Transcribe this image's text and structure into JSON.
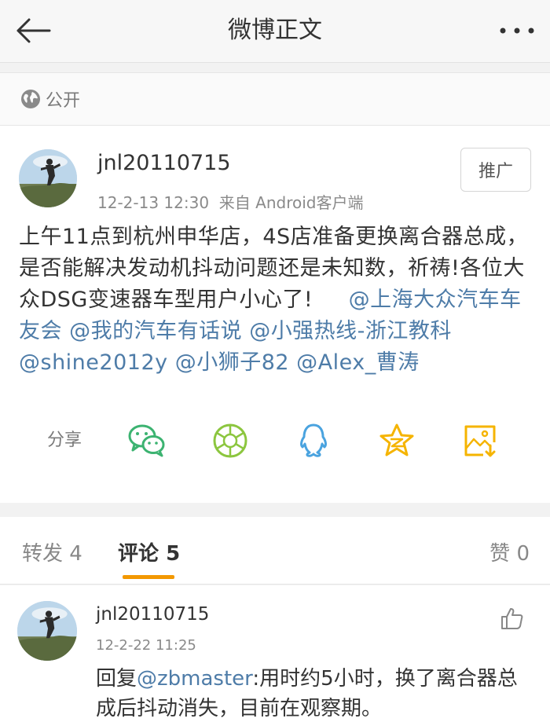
{
  "header": {
    "title": "微博正文"
  },
  "visibility": {
    "label": "公开"
  },
  "post": {
    "author": "jnl20110715",
    "timestamp": "12-2-13 12:30",
    "source": "来自 Android客户端",
    "promote_label": "推广",
    "text_plain": "上午11点到杭州申华店，4S店准备更换离合器总成，是否能解决发动机抖动问题还是未知数，祈祷!各位大众DSG变速器车型用户小心了!",
    "mentions": [
      "@上海大众汽车车友会",
      "@我的汽车有话说",
      "@小强热线-浙江教科",
      "@shine2012y",
      "@小狮子82",
      "@Alex_曹涛"
    ]
  },
  "share": {
    "label": "分享",
    "targets": [
      "wechat-icon",
      "moments-icon",
      "qq-icon",
      "qzone-icon",
      "save-image-icon"
    ]
  },
  "tabs": {
    "repost_label": "转发",
    "repost_count": "4",
    "comment_label": "评论",
    "comment_count": "5",
    "like_label": "赞",
    "like_count": "0"
  },
  "comment": {
    "author": "jnl20110715",
    "timestamp": "12-2-22 11:25",
    "reply_prefix": "回复",
    "reply_to": "@zbmaster",
    "text": ":用时约5小时，换了离合器总成后抖动消失，目前在观察期。"
  },
  "colors": {
    "link": "#4e7ca8",
    "accent": "#f39800",
    "wechat": "#3cb371",
    "moments": "#8cc63f",
    "qq": "#4aa3df",
    "qzone": "#f5b400"
  }
}
